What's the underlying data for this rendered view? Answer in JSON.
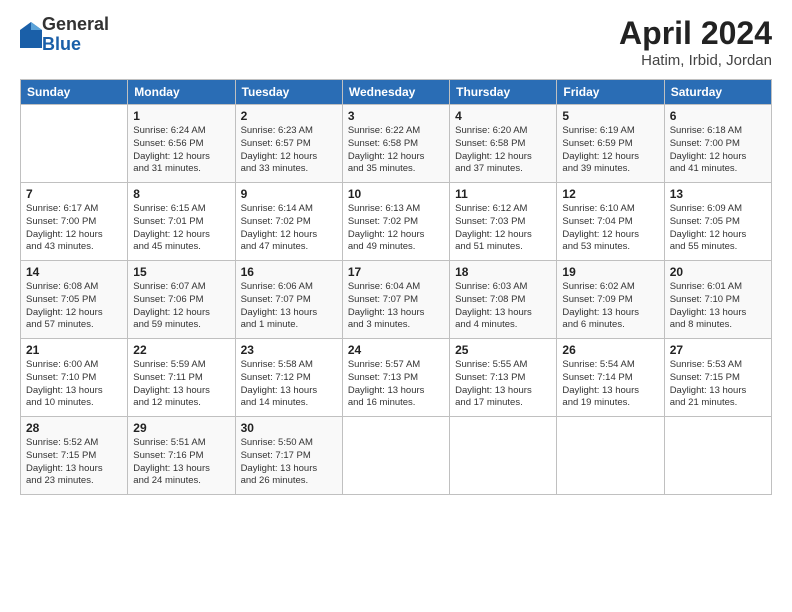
{
  "logo": {
    "general": "General",
    "blue": "Blue"
  },
  "title": "April 2024",
  "location": "Hatim, Irbid, Jordan",
  "days_of_week": [
    "Sunday",
    "Monday",
    "Tuesday",
    "Wednesday",
    "Thursday",
    "Friday",
    "Saturday"
  ],
  "weeks": [
    [
      {
        "day": "",
        "info": ""
      },
      {
        "day": "1",
        "info": "Sunrise: 6:24 AM\nSunset: 6:56 PM\nDaylight: 12 hours\nand 31 minutes."
      },
      {
        "day": "2",
        "info": "Sunrise: 6:23 AM\nSunset: 6:57 PM\nDaylight: 12 hours\nand 33 minutes."
      },
      {
        "day": "3",
        "info": "Sunrise: 6:22 AM\nSunset: 6:58 PM\nDaylight: 12 hours\nand 35 minutes."
      },
      {
        "day": "4",
        "info": "Sunrise: 6:20 AM\nSunset: 6:58 PM\nDaylight: 12 hours\nand 37 minutes."
      },
      {
        "day": "5",
        "info": "Sunrise: 6:19 AM\nSunset: 6:59 PM\nDaylight: 12 hours\nand 39 minutes."
      },
      {
        "day": "6",
        "info": "Sunrise: 6:18 AM\nSunset: 7:00 PM\nDaylight: 12 hours\nand 41 minutes."
      }
    ],
    [
      {
        "day": "7",
        "info": "Sunrise: 6:17 AM\nSunset: 7:00 PM\nDaylight: 12 hours\nand 43 minutes."
      },
      {
        "day": "8",
        "info": "Sunrise: 6:15 AM\nSunset: 7:01 PM\nDaylight: 12 hours\nand 45 minutes."
      },
      {
        "day": "9",
        "info": "Sunrise: 6:14 AM\nSunset: 7:02 PM\nDaylight: 12 hours\nand 47 minutes."
      },
      {
        "day": "10",
        "info": "Sunrise: 6:13 AM\nSunset: 7:02 PM\nDaylight: 12 hours\nand 49 minutes."
      },
      {
        "day": "11",
        "info": "Sunrise: 6:12 AM\nSunset: 7:03 PM\nDaylight: 12 hours\nand 51 minutes."
      },
      {
        "day": "12",
        "info": "Sunrise: 6:10 AM\nSunset: 7:04 PM\nDaylight: 12 hours\nand 53 minutes."
      },
      {
        "day": "13",
        "info": "Sunrise: 6:09 AM\nSunset: 7:05 PM\nDaylight: 12 hours\nand 55 minutes."
      }
    ],
    [
      {
        "day": "14",
        "info": "Sunrise: 6:08 AM\nSunset: 7:05 PM\nDaylight: 12 hours\nand 57 minutes."
      },
      {
        "day": "15",
        "info": "Sunrise: 6:07 AM\nSunset: 7:06 PM\nDaylight: 12 hours\nand 59 minutes."
      },
      {
        "day": "16",
        "info": "Sunrise: 6:06 AM\nSunset: 7:07 PM\nDaylight: 13 hours\nand 1 minute."
      },
      {
        "day": "17",
        "info": "Sunrise: 6:04 AM\nSunset: 7:07 PM\nDaylight: 13 hours\nand 3 minutes."
      },
      {
        "day": "18",
        "info": "Sunrise: 6:03 AM\nSunset: 7:08 PM\nDaylight: 13 hours\nand 4 minutes."
      },
      {
        "day": "19",
        "info": "Sunrise: 6:02 AM\nSunset: 7:09 PM\nDaylight: 13 hours\nand 6 minutes."
      },
      {
        "day": "20",
        "info": "Sunrise: 6:01 AM\nSunset: 7:10 PM\nDaylight: 13 hours\nand 8 minutes."
      }
    ],
    [
      {
        "day": "21",
        "info": "Sunrise: 6:00 AM\nSunset: 7:10 PM\nDaylight: 13 hours\nand 10 minutes."
      },
      {
        "day": "22",
        "info": "Sunrise: 5:59 AM\nSunset: 7:11 PM\nDaylight: 13 hours\nand 12 minutes."
      },
      {
        "day": "23",
        "info": "Sunrise: 5:58 AM\nSunset: 7:12 PM\nDaylight: 13 hours\nand 14 minutes."
      },
      {
        "day": "24",
        "info": "Sunrise: 5:57 AM\nSunset: 7:13 PM\nDaylight: 13 hours\nand 16 minutes."
      },
      {
        "day": "25",
        "info": "Sunrise: 5:55 AM\nSunset: 7:13 PM\nDaylight: 13 hours\nand 17 minutes."
      },
      {
        "day": "26",
        "info": "Sunrise: 5:54 AM\nSunset: 7:14 PM\nDaylight: 13 hours\nand 19 minutes."
      },
      {
        "day": "27",
        "info": "Sunrise: 5:53 AM\nSunset: 7:15 PM\nDaylight: 13 hours\nand 21 minutes."
      }
    ],
    [
      {
        "day": "28",
        "info": "Sunrise: 5:52 AM\nSunset: 7:15 PM\nDaylight: 13 hours\nand 23 minutes."
      },
      {
        "day": "29",
        "info": "Sunrise: 5:51 AM\nSunset: 7:16 PM\nDaylight: 13 hours\nand 24 minutes."
      },
      {
        "day": "30",
        "info": "Sunrise: 5:50 AM\nSunset: 7:17 PM\nDaylight: 13 hours\nand 26 minutes."
      },
      {
        "day": "",
        "info": ""
      },
      {
        "day": "",
        "info": ""
      },
      {
        "day": "",
        "info": ""
      },
      {
        "day": "",
        "info": ""
      }
    ]
  ]
}
